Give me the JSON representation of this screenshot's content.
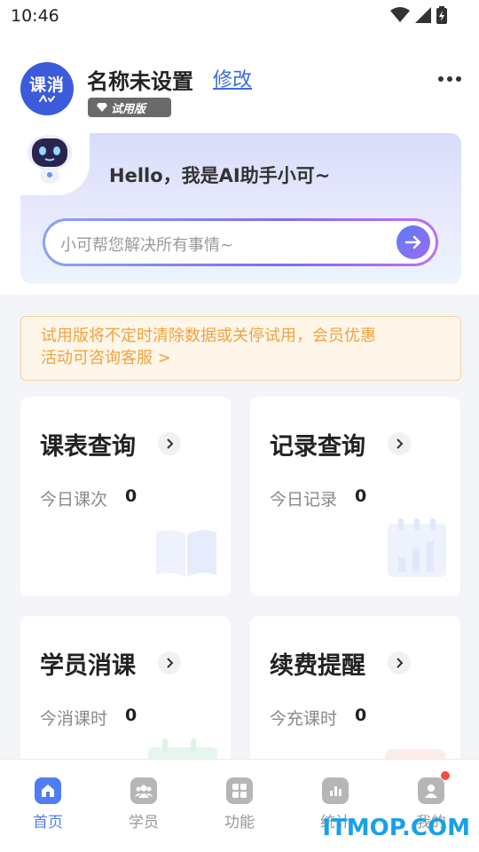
{
  "status": {
    "time": "10:46"
  },
  "profile": {
    "avatar_text": "课消",
    "avatar_sub": "^",
    "name": "名称未设置",
    "edit_label": "修改",
    "badge": "试用版"
  },
  "assistant": {
    "greeting": "Hello，我是AI助手小可~",
    "placeholder": "小可帮您解决所有事情~"
  },
  "notice": {
    "line1": "试用版将不定时清除数据或关停试用，会员优惠",
    "line2": "活动可咨询客服 >"
  },
  "cards": [
    {
      "title": "课表查询",
      "label": "今日课次",
      "value": "0",
      "icon": "book-icon"
    },
    {
      "title": "记录查询",
      "label": "今日记录",
      "value": "0",
      "icon": "calendar-chart-icon"
    },
    {
      "title": "学员消课",
      "label": "今消课时",
      "value": "0",
      "icon": "calendar-icon"
    },
    {
      "title": "续费提醒",
      "label": "今充课时",
      "value": "0",
      "icon": "reminder-icon"
    }
  ],
  "nav": [
    {
      "label": "首页",
      "icon": "home-icon",
      "active": true
    },
    {
      "label": "学员",
      "icon": "users-icon"
    },
    {
      "label": "功能",
      "icon": "grid-icon"
    },
    {
      "label": "统计",
      "icon": "bar-chart-icon"
    },
    {
      "label": "我的",
      "icon": "profile-icon"
    }
  ],
  "colors": {
    "accent": "#4f7df6",
    "notice_text": "#f0a23c",
    "notification_dot": "#f24b4b"
  },
  "watermark": "ITMOP.COM"
}
